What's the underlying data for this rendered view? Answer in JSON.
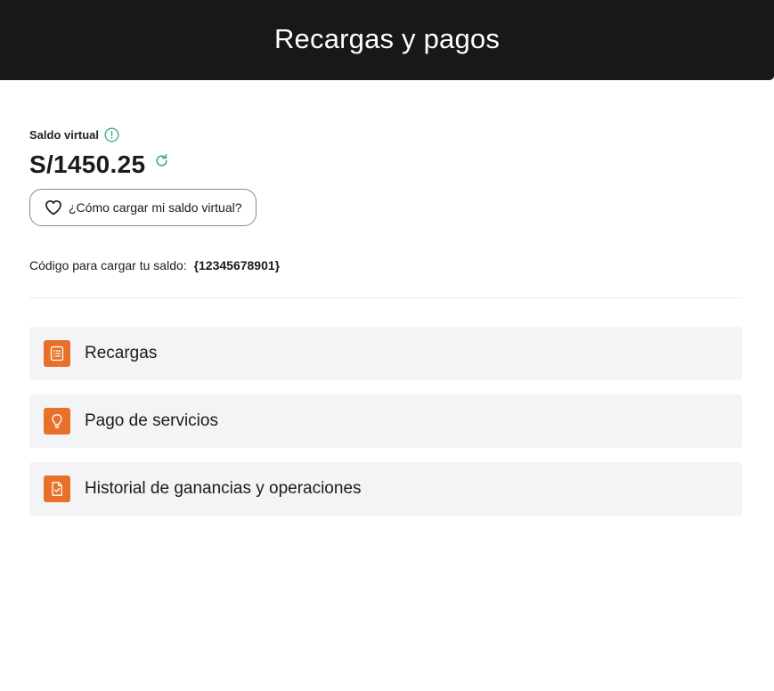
{
  "header": {
    "title": "Recargas y pagos"
  },
  "balance": {
    "label": "Saldo virtual",
    "amount": "S/1450.25",
    "info_icon": "info-icon",
    "refresh_icon": "refresh-icon"
  },
  "help_button": {
    "label": "¿Cómo cargar mi saldo virtual?",
    "icon": "heart-icon"
  },
  "code": {
    "label": "Código para cargar tu saldo:",
    "value": "{12345678901}"
  },
  "menu": {
    "items": [
      {
        "label": "Recargas",
        "icon": "receipt-icon"
      },
      {
        "label": "Pago de servicios",
        "icon": "lightbulb-icon"
      },
      {
        "label": "Historial de ganancias y operaciones",
        "icon": "document-check-icon"
      }
    ]
  },
  "colors": {
    "header_bg": "#18181a",
    "accent_orange": "#e8702a",
    "accent_green": "#3aa88a",
    "menu_bg": "#f3f4f6"
  }
}
